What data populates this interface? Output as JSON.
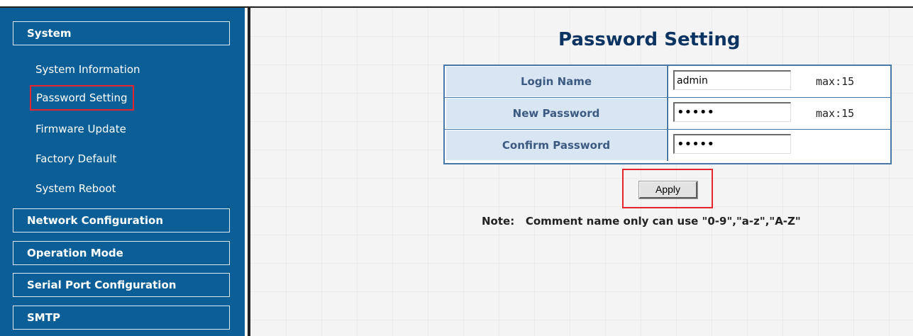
{
  "sidebar": {
    "sections": [
      {
        "label": "System",
        "items": [
          {
            "label": "System Information"
          },
          {
            "label": "Password Setting",
            "selected": true
          },
          {
            "label": "Firmware Update"
          },
          {
            "label": "Factory Default"
          },
          {
            "label": "System Reboot"
          }
        ]
      },
      {
        "label": "Network Configuration"
      },
      {
        "label": "Operation Mode"
      },
      {
        "label": "Serial Port Configuration"
      },
      {
        "label": "SMTP"
      }
    ]
  },
  "main": {
    "title": "Password Setting",
    "form": {
      "rows": [
        {
          "label": "Login Name",
          "value": "admin",
          "hint": "max:15"
        },
        {
          "label": "New Password",
          "value": "•••••",
          "hint": "max:15"
        },
        {
          "label": "Confirm Password",
          "value": "•••••",
          "hint": ""
        }
      ]
    },
    "apply_label": "Apply",
    "note": "Note:   Comment name only can use \"0-9\",\"a-z\",\"A-Z\""
  },
  "colors": {
    "sidebar_bg": "#0b5e96",
    "title": "#0b3463",
    "label_bg": "#d8e6f4",
    "highlight": "#e5252f"
  }
}
